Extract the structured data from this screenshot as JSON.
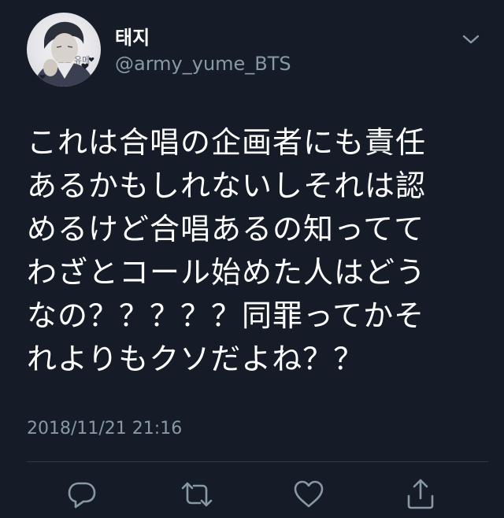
{
  "tweet": {
    "author": {
      "display_name": "태지",
      "handle": "@army_yume_BTS",
      "avatar_text": "유메"
    },
    "text_lines": [
      "これは合唱の企画者にも責任",
      "あるかもしれないしそれは認",
      "めるけど合唱あるの知ってて",
      "わざとコール始めた人はどう",
      "なの？？？？？同罪ってかそ",
      "れよりもクソだよね？？"
    ],
    "timestamp": "2018/11/21 21:16",
    "actions": {
      "reply_icon": "reply-icon",
      "retweet_icon": "retweet-icon",
      "like_icon": "heart-icon",
      "share_icon": "share-icon"
    }
  },
  "colors": {
    "background": "#151c28",
    "primary_text": "#ffffff",
    "secondary_text": "#8899a6",
    "divider": "#2f3a47"
  }
}
